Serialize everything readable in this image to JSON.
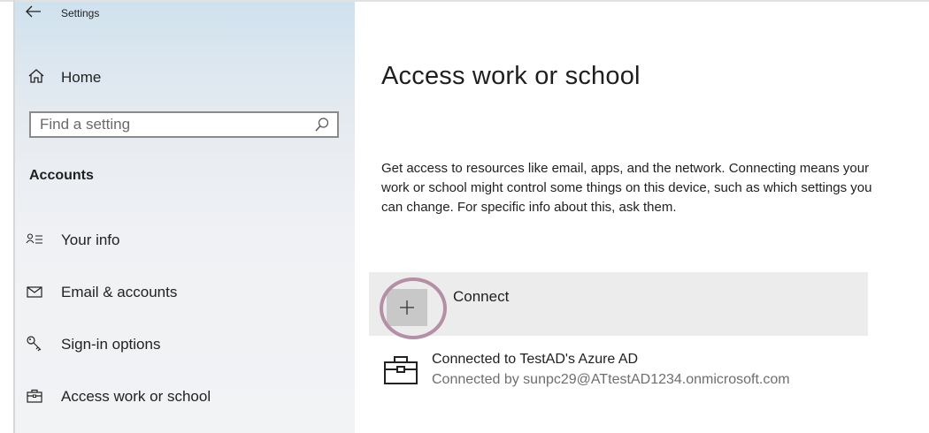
{
  "window": {
    "title": "Settings",
    "back_icon": "back-arrow-icon"
  },
  "sidebar": {
    "home_label": "Home",
    "search_placeholder": "Find a setting",
    "section_title": "Accounts",
    "items": [
      {
        "label": "Your info",
        "icon": "person-list-icon"
      },
      {
        "label": "Email & accounts",
        "icon": "envelope-icon"
      },
      {
        "label": "Sign-in options",
        "icon": "key-icon"
      },
      {
        "label": "Access work or school",
        "icon": "briefcase-icon"
      }
    ]
  },
  "main": {
    "title": "Access work or school",
    "description": "Get access to resources like email, apps, and the network. Connecting means your work or school might control some things on this device, such as which settings you can change. For specific info about this, ask them.",
    "connect_label": "Connect",
    "account": {
      "name": "Connected to TestAD's Azure AD",
      "detail": "Connected by sunpc29@ATtestAD1234.onmicrosoft.com"
    }
  },
  "colors": {
    "highlight_ring": "#b48fa5",
    "connect_row_bg": "#ececec",
    "plus_button_bg": "#c8c8c8",
    "secondary_text": "#6e6e6e"
  }
}
